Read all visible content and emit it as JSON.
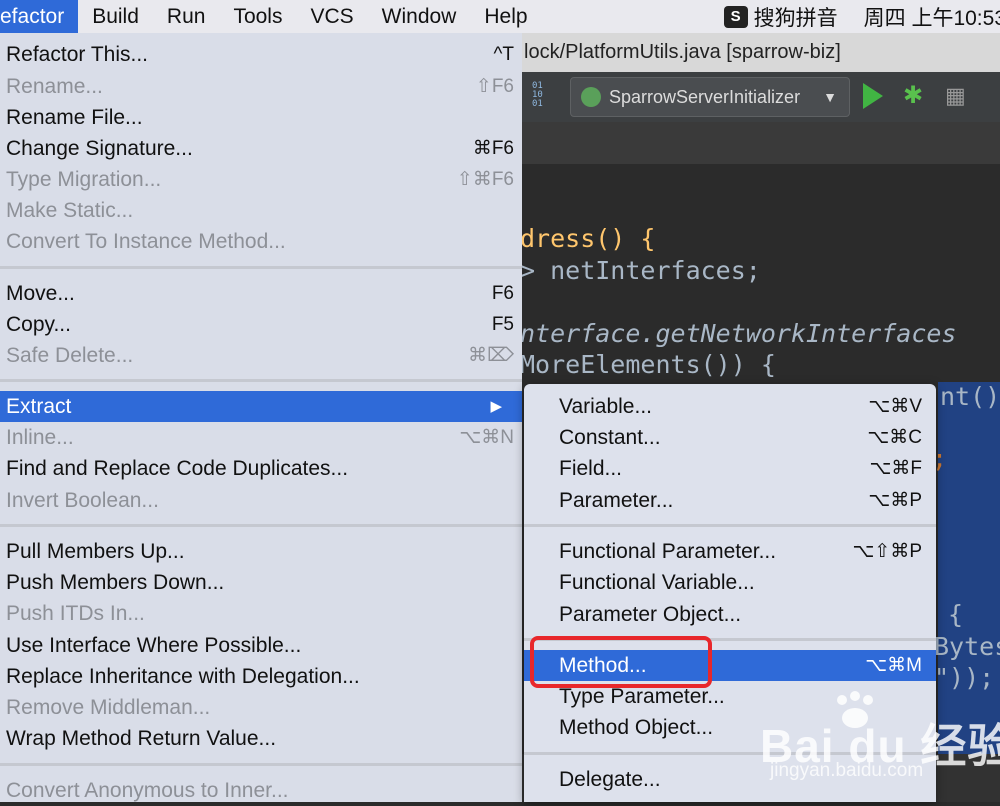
{
  "menubar": {
    "items": [
      "efactor",
      "Build",
      "Run",
      "Tools",
      "VCS",
      "Window",
      "Help"
    ],
    "ime_icon": "S",
    "ime_label": "搜狗拼音",
    "clock": "周四 上午10:53"
  },
  "window": {
    "title": "lock/PlatformUtils.java [sparrow-biz]"
  },
  "toolbar": {
    "run_config": "SparrowServerInitializer",
    "run_config_icon": "spring-gear-icon",
    "binary_icon_text": "01 10 01"
  },
  "editor": {
    "lines": [
      {
        "text": "dress() {"
      },
      {
        "text": "> netInterfaces;"
      },
      {
        "text": "nterface.getNetworkInterfaces"
      },
      {
        "text": "MoreElements()) {"
      },
      {
        "text": "nt()"
      },
      {
        "text": ";"
      },
      {
        "text": "{"
      },
      {
        "text": "Bytes"
      },
      {
        "text": "\"));"
      }
    ]
  },
  "refactor_menu": {
    "items": [
      {
        "label": "Refactor This...",
        "shortcut": "^T",
        "enabled": true
      },
      {
        "label": "Rename...",
        "shortcut": "⇧F6",
        "enabled": false
      },
      {
        "label": "Rename File...",
        "shortcut": "",
        "enabled": true
      },
      {
        "label": "Change Signature...",
        "shortcut": "⌘F6",
        "enabled": true
      },
      {
        "label": "Type Migration...",
        "shortcut": "⇧⌘F6",
        "enabled": false
      },
      {
        "label": "Make Static...",
        "shortcut": "",
        "enabled": false
      },
      {
        "label": "Convert To Instance Method...",
        "shortcut": "",
        "enabled": false
      },
      {
        "label": "Move...",
        "shortcut": "F6",
        "enabled": true
      },
      {
        "label": "Copy...",
        "shortcut": "F5",
        "enabled": true
      },
      {
        "label": "Safe Delete...",
        "shortcut": "⌘⌦",
        "enabled": false
      },
      {
        "label": "Extract",
        "shortcut": "▶",
        "enabled": true
      },
      {
        "label": "Inline...",
        "shortcut": "⌥⌘N",
        "enabled": false
      },
      {
        "label": "Find and Replace Code Duplicates...",
        "shortcut": "",
        "enabled": true
      },
      {
        "label": "Invert Boolean...",
        "shortcut": "",
        "enabled": false
      },
      {
        "label": "Pull Members Up...",
        "shortcut": "",
        "enabled": true
      },
      {
        "label": "Push Members Down...",
        "shortcut": "",
        "enabled": true
      },
      {
        "label": "Push ITDs In...",
        "shortcut": "",
        "enabled": false
      },
      {
        "label": "Use Interface Where Possible...",
        "shortcut": "",
        "enabled": true
      },
      {
        "label": "Replace Inheritance with Delegation...",
        "shortcut": "",
        "enabled": true
      },
      {
        "label": "Remove Middleman...",
        "shortcut": "",
        "enabled": false
      },
      {
        "label": "Wrap Method Return Value...",
        "shortcut": "",
        "enabled": true
      },
      {
        "label": "Convert Anonymous to Inner...",
        "shortcut": "",
        "enabled": false
      }
    ]
  },
  "extract_submenu": {
    "items": [
      {
        "label": "Variable...",
        "shortcut": "⌥⌘V"
      },
      {
        "label": "Constant...",
        "shortcut": "⌥⌘C"
      },
      {
        "label": "Field...",
        "shortcut": "⌥⌘F"
      },
      {
        "label": "Parameter...",
        "shortcut": "⌥⌘P"
      },
      {
        "label": "Functional Parameter...",
        "shortcut": "⌥⇧⌘P"
      },
      {
        "label": "Functional Variable...",
        "shortcut": ""
      },
      {
        "label": "Parameter Object...",
        "shortcut": ""
      },
      {
        "label": "Method...",
        "shortcut": "⌥⌘M"
      },
      {
        "label": "Type Parameter...",
        "shortcut": ""
      },
      {
        "label": "Method Object...",
        "shortcut": ""
      },
      {
        "label": "Delegate...",
        "shortcut": ""
      }
    ],
    "selected": "Method..."
  },
  "watermark": {
    "text": "Bai du 经验",
    "url": "jingyan.baidu.com"
  },
  "colors": {
    "selection": "#2f6ad8",
    "highlight_box": "#e8272b",
    "menu_bg": "#d9dde8"
  }
}
